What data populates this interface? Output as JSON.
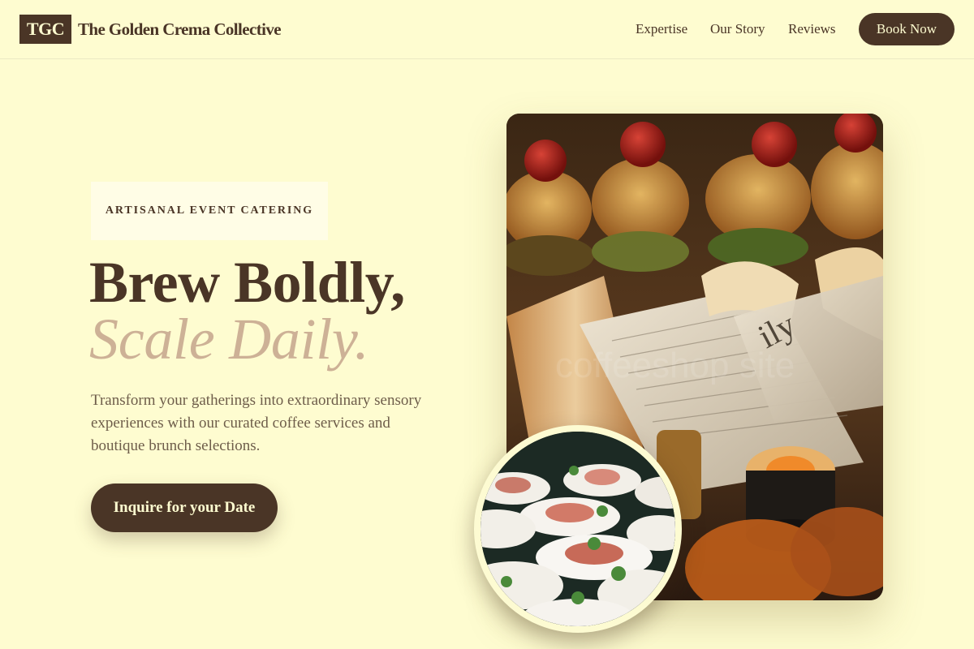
{
  "header": {
    "logo_text": "TGC",
    "brand_name": "The Golden Crema Collective",
    "nav": [
      "Expertise",
      "Our Story",
      "Reviews"
    ],
    "cta_label": "Book Now"
  },
  "hero": {
    "eyebrow": "ARTISANAL EVENT CATERING",
    "headline_line1": "Brew Boldly,",
    "headline_line2": "Scale Daily.",
    "description": "Transform your gatherings into extraordinary sensory experiences with our curated coffee services and boutique brunch selections.",
    "cta_label": "Inquire for your Date"
  },
  "images": {
    "main_photo_icon": "catering-platter-photo",
    "circle_photo_icon": "appetizer-plates-photo"
  },
  "colors": {
    "background": "#fefcd0",
    "primary_brown": "#4a3526",
    "accent_tan": "#cdb196",
    "eyebrow_bg": "#fffde6"
  }
}
